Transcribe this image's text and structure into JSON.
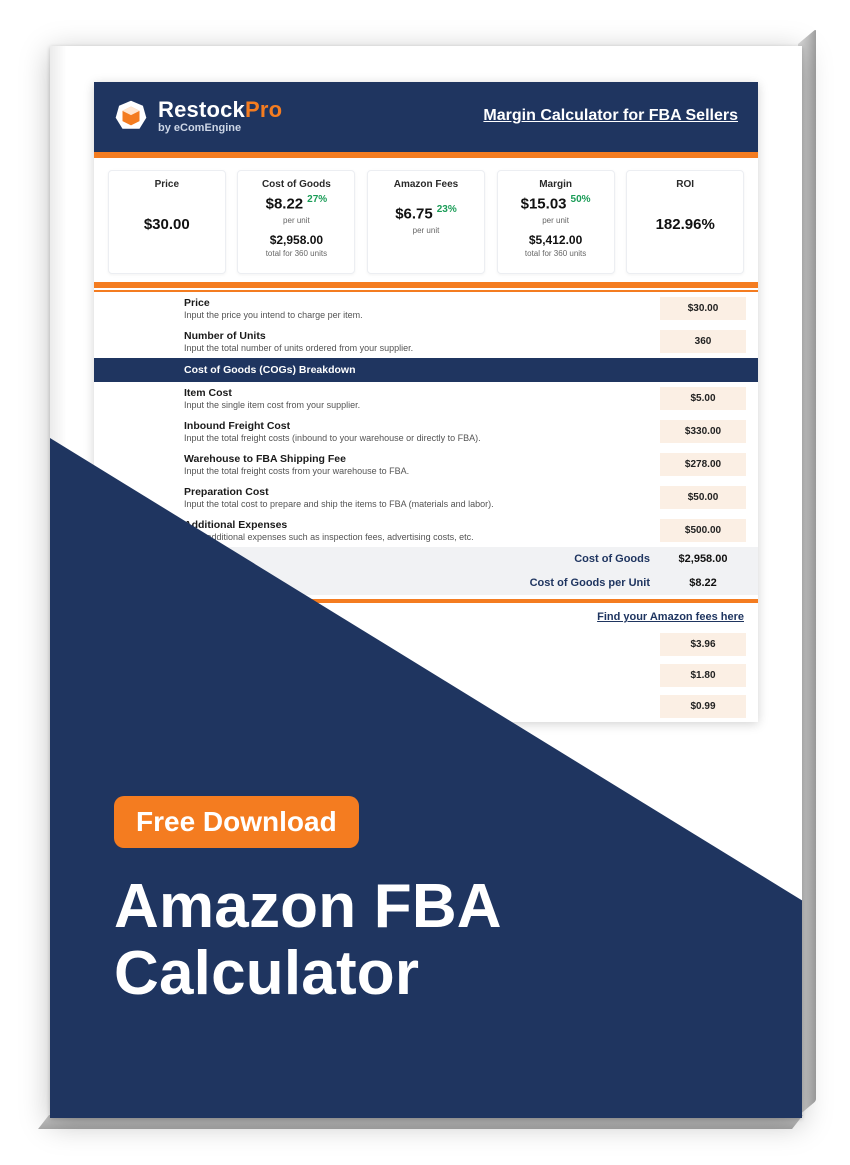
{
  "brand": {
    "name_part1": "Restock",
    "name_part2": "Pro",
    "subtitle": "by eComEngine"
  },
  "header_title": "Margin Calculator for FBA Sellers",
  "metrics": {
    "price": {
      "label": "Price",
      "value": "$30.00"
    },
    "cogs": {
      "label": "Cost of Goods",
      "value": "$8.22",
      "pct": "27%",
      "per": "per unit",
      "total": "$2,958.00",
      "total_sub": "total for 360 units"
    },
    "fees": {
      "label": "Amazon Fees",
      "value": "$6.75",
      "pct": "23%",
      "per": "per unit"
    },
    "margin": {
      "label": "Margin",
      "value": "$15.03",
      "pct": "50%",
      "per": "per unit",
      "total": "$5,412.00",
      "total_sub": "total for 360 units"
    },
    "roi": {
      "label": "ROI",
      "value": "182.96%"
    }
  },
  "inputs": {
    "price": {
      "title": "Price",
      "desc": "Input the price you intend to charge per item.",
      "value": "$30.00"
    },
    "units": {
      "title": "Number of Units",
      "desc": "Input the total number of units ordered from your supplier.",
      "value": "360"
    }
  },
  "cogs_section_title": "Cost of Goods (COGs) Breakdown",
  "cogs_rows": [
    {
      "title": "Item Cost",
      "desc": "Input the single item cost from your supplier.",
      "value": "$5.00"
    },
    {
      "title": "Inbound Freight Cost",
      "desc": "Input the total freight costs (inbound to your warehouse or directly to FBA).",
      "value": "$330.00"
    },
    {
      "title": "Warehouse to FBA Shipping Fee",
      "desc": "Input the total freight costs from your warehouse to FBA.",
      "value": "$278.00"
    },
    {
      "title": "Preparation Cost",
      "desc": "Input the total cost to prepare and ship the items to FBA (materials and labor).",
      "value": "$50.00"
    },
    {
      "title": "Additional Expenses",
      "desc": "Input additional expenses such as inspection fees, advertising costs, etc.",
      "value": "$500.00"
    }
  ],
  "cogs_totals": {
    "total": {
      "label": "Cost of Goods",
      "value": "$2,958.00"
    },
    "per_unit": {
      "label": "Cost of Goods per Unit",
      "value": "$8.22"
    }
  },
  "fees_link": "Find your Amazon fees here",
  "fees_values": [
    "$3.96",
    "$1.80",
    "$0.99"
  ],
  "promo": {
    "pill": "Free Download",
    "title_line1": "Amazon FBA",
    "title_line2": "Calculator"
  }
}
